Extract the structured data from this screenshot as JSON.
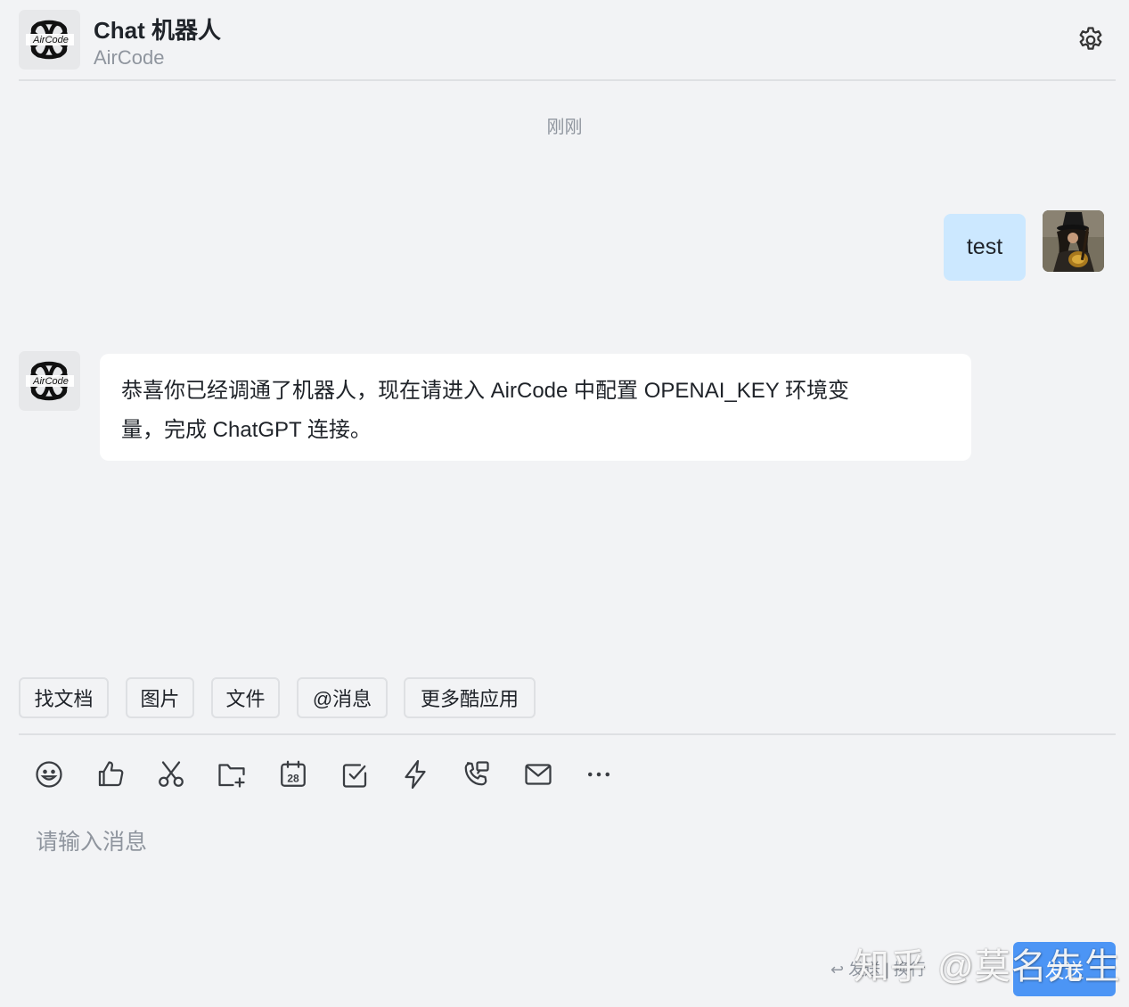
{
  "header": {
    "title": "Chat 机器人",
    "subtitle": "AirCode",
    "logo_text": "AirCode"
  },
  "chat": {
    "time_label": "刚刚",
    "messages": [
      {
        "direction": "outgoing",
        "text": "test"
      },
      {
        "direction": "incoming",
        "line1": "恭喜你已经调通了机器人，现在请进入 AirCode 中配置 OPENAI_KEY 环境变",
        "line2": "量，完成 ChatGPT 连接。"
      }
    ]
  },
  "quick_actions": [
    "找文档",
    "图片",
    "文件",
    "@消息",
    "更多酷应用"
  ],
  "toolbar_icons": [
    "emoji-icon",
    "thumbs-up-icon",
    "scissors-icon",
    "folder-add-icon",
    "calendar-icon",
    "checkbox-icon",
    "lightning-icon",
    "phone-icon",
    "mail-icon",
    "more-icon"
  ],
  "calendar_day": "28",
  "input": {
    "placeholder": "请输入消息"
  },
  "footer": {
    "hint": "↩ 发送 | 换行",
    "send_label": "发送",
    "watermark": "知乎 @莫名先生"
  },
  "colors": {
    "background": "#f2f3f5",
    "outgoing_bubble": "#cce8ff",
    "incoming_bubble": "#ffffff",
    "send_button": "#4c95f5",
    "muted_text": "#8f959e"
  }
}
